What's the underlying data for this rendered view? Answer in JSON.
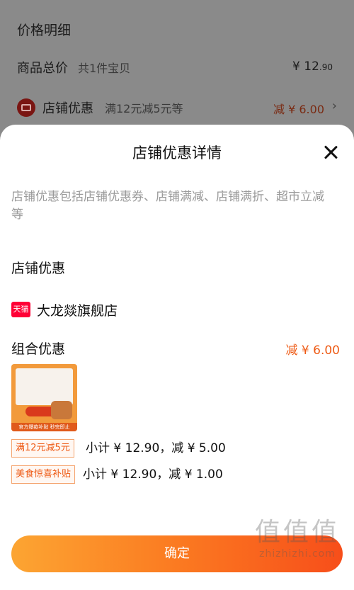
{
  "background": {
    "title": "价格明细",
    "goods_total": {
      "label": "商品总价",
      "sub": "共1件宝贝",
      "currency": "¥",
      "int": "12",
      "dec": ".90"
    },
    "store_discount": {
      "label": "店铺优惠",
      "sub": "满12元减5元等",
      "amount": "减 ¥ 6.00"
    }
  },
  "sheet": {
    "title": "店铺优惠详情",
    "description": "店铺优惠包括店铺优惠券、店铺满减、店铺满折、超市立减等",
    "section_title": "店铺优惠",
    "store": {
      "badge": "天猫",
      "name": "大龙燚旗舰店"
    },
    "combo": {
      "title": "组合优惠",
      "amount": "减 ¥ 6.00"
    },
    "product_thumb": {
      "band_text": "官方爆款补贴 秒完即止"
    },
    "promotions": [
      {
        "tag": "满12元减5元",
        "text": "小计 ¥ 12.90，减 ¥ 5.00"
      },
      {
        "tag": "美食惊喜补贴",
        "text": "小计 ¥ 12.90，减 ¥ 1.00"
      }
    ],
    "confirm_label": "确定"
  },
  "watermark": {
    "big": "值值值",
    "small": "zhizhizhi.com"
  },
  "colors": {
    "accent": "#ee5a14",
    "tmall": "#ff0036",
    "button_start": "#fca532",
    "button_end": "#f74e1a"
  }
}
